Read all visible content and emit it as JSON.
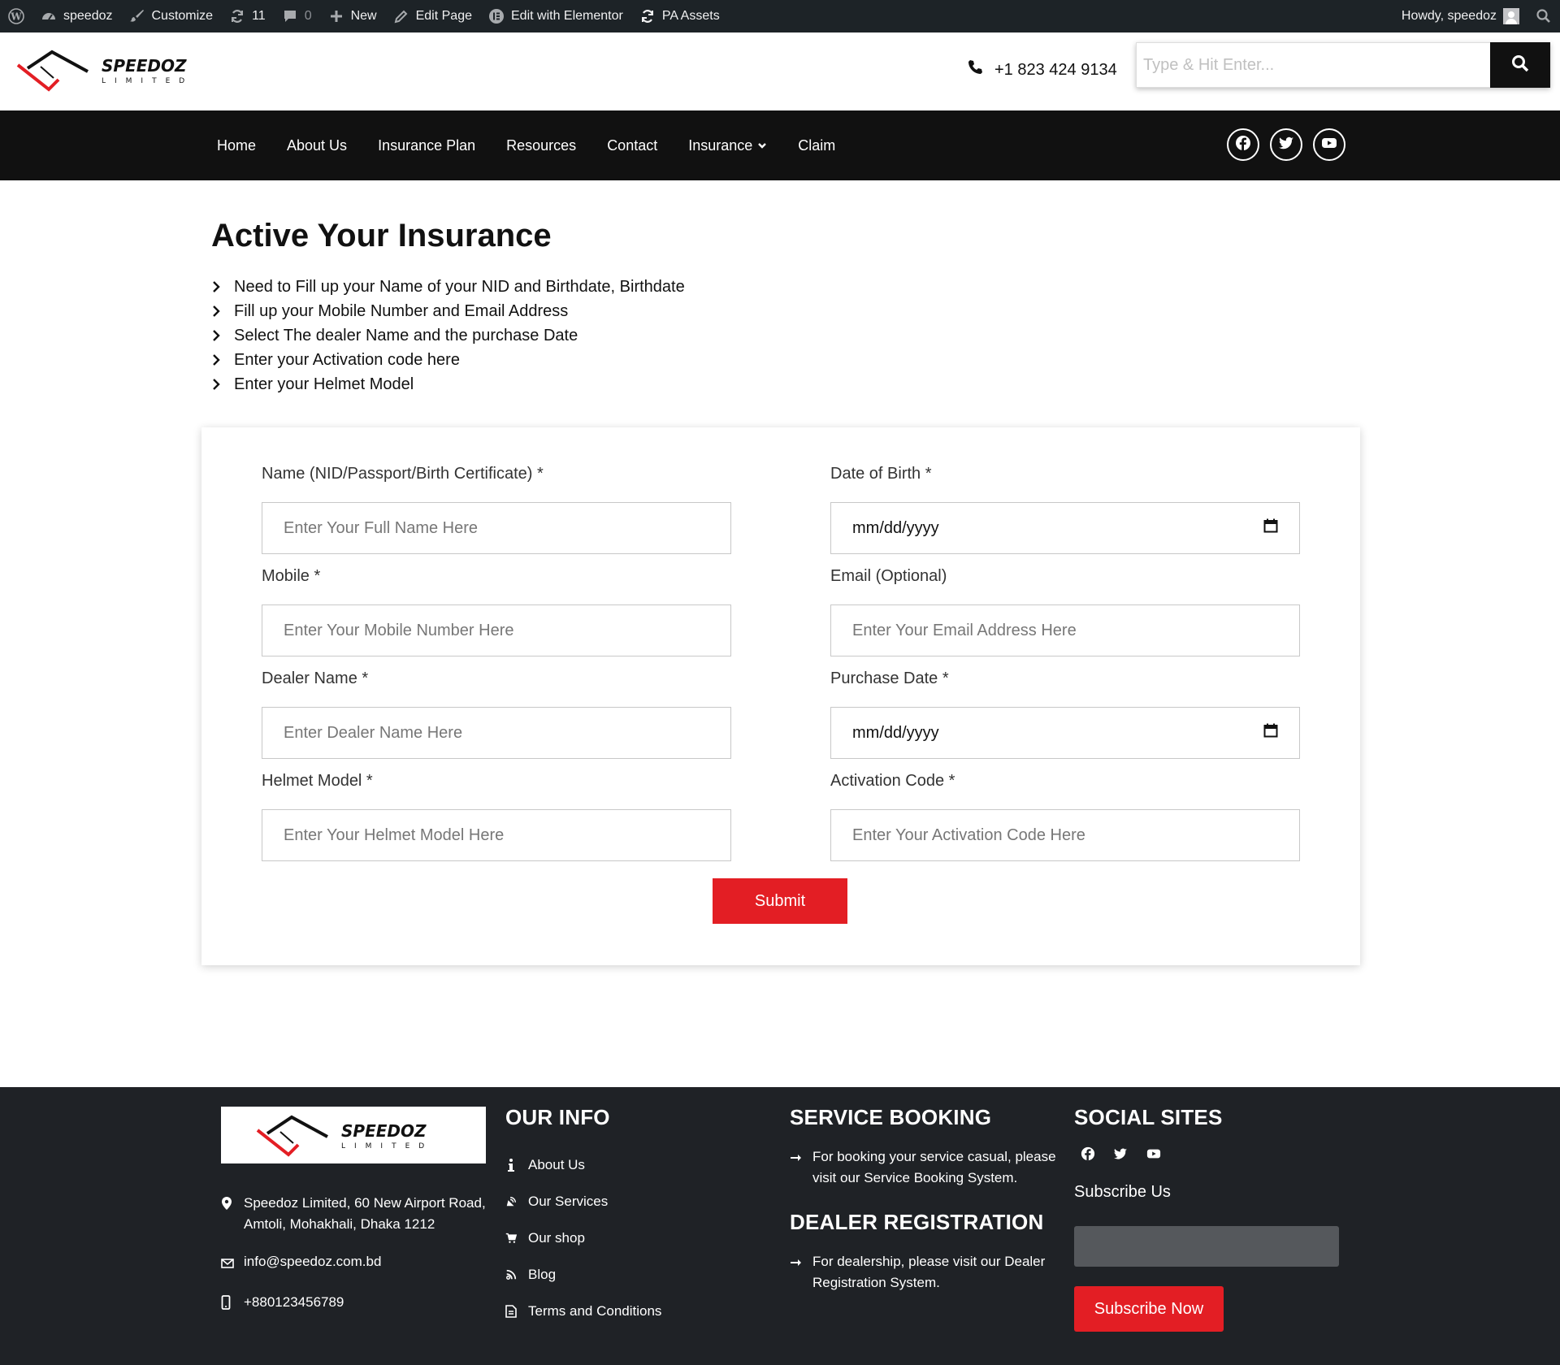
{
  "admin_bar": {
    "site_name": "speedoz",
    "customize": "Customize",
    "updates_count": "11",
    "comments_count": "0",
    "new": "New",
    "edit_page": "Edit Page",
    "edit_elementor": "Edit with Elementor",
    "pa_assets": "PA Assets",
    "greeting": "Howdy, speedoz"
  },
  "header": {
    "phone": "+1 823 424 9134",
    "search_placeholder": "Type & Hit Enter..."
  },
  "brand": {
    "name": "SPEEDOZ",
    "sub": "LIMITED",
    "accent": "#e31e24"
  },
  "nav": {
    "items": [
      "Home",
      "About Us",
      "Insurance Plan",
      "Resources",
      "Contact",
      "Insurance",
      "Claim"
    ]
  },
  "main": {
    "title": "Active Your Insurance",
    "steps": [
      "Need to Fill up your Name of your NID and Birthdate, Birthdate",
      "Fill up your Mobile Number and Email Address",
      "Select The dealer Name and the purchase Date",
      "Enter your Activation code here",
      "Enter your Helmet Model"
    ]
  },
  "form": {
    "name": {
      "label": "Name (NID/Passport/Birth Certificate) *",
      "placeholder": "Enter Your Full Name Here"
    },
    "dob": {
      "label": "Date of Birth *",
      "value": "mm/dd/yyyy"
    },
    "mobile": {
      "label": "Mobile *",
      "placeholder": "Enter Your Mobile Number Here"
    },
    "email": {
      "label": "Email (Optional)",
      "placeholder": "Enter Your Email Address Here"
    },
    "dealer": {
      "label": "Dealer Name *",
      "placeholder": "Enter Dealer Name Here"
    },
    "purchase": {
      "label": "Purchase Date *",
      "value": "mm/dd/yyyy"
    },
    "helmet": {
      "label": "Helmet Model *",
      "placeholder": "Enter Your Helmet Model Here"
    },
    "activation": {
      "label": "Activation Code *",
      "placeholder": "Enter Your Activation Code Here"
    },
    "submit": "Submit"
  },
  "footer": {
    "address": "Speedoz Limited, 60 New Airport Road, Amtoli, Mohakhali, Dhaka 1212",
    "email": "info@speedoz.com.bd",
    "phone": "+880123456789",
    "our_info": {
      "title": "OUR INFO",
      "links": [
        "About Us",
        "Our Services",
        "Our shop",
        "Blog",
        "Terms and Conditions"
      ]
    },
    "service_booking": {
      "title": "SERVICE BOOKING",
      "text": "For booking your service casual, please visit our Service Booking System."
    },
    "dealer_registration": {
      "title": "DEALER REGISTRATION",
      "text": "For dealership, please visit our Dealer Registration System."
    },
    "social": {
      "title": "SOCIAL SITES",
      "subscribe_label": "Subscribe Us",
      "subscribe_button": "Subscribe Now"
    }
  }
}
